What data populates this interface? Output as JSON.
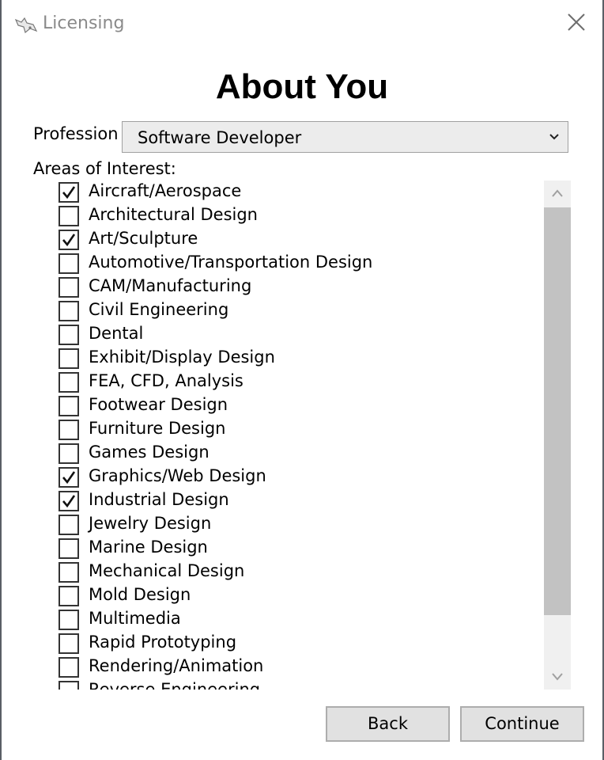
{
  "window": {
    "title": "Licensing"
  },
  "heading": "About You",
  "profession": {
    "label": "Profession",
    "selected": "Software Developer"
  },
  "interests": {
    "label": "Areas of Interest:",
    "items": [
      {
        "label": "Aircraft/Aerospace",
        "checked": true
      },
      {
        "label": "Architectural Design",
        "checked": false
      },
      {
        "label": "Art/Sculpture",
        "checked": true
      },
      {
        "label": "Automotive/Transportation Design",
        "checked": false
      },
      {
        "label": "CAM/Manufacturing",
        "checked": false
      },
      {
        "label": "Civil Engineering",
        "checked": false
      },
      {
        "label": "Dental",
        "checked": false
      },
      {
        "label": "Exhibit/Display Design",
        "checked": false
      },
      {
        "label": "FEA, CFD, Analysis",
        "checked": false
      },
      {
        "label": "Footwear Design",
        "checked": false
      },
      {
        "label": "Furniture Design",
        "checked": false
      },
      {
        "label": "Games Design",
        "checked": false
      },
      {
        "label": "Graphics/Web Design",
        "checked": true
      },
      {
        "label": "Industrial Design",
        "checked": true
      },
      {
        "label": "Jewelry Design",
        "checked": false
      },
      {
        "label": "Marine Design",
        "checked": false
      },
      {
        "label": "Mechanical Design",
        "checked": false
      },
      {
        "label": "Mold Design",
        "checked": false
      },
      {
        "label": "Multimedia",
        "checked": false
      },
      {
        "label": "Rapid Prototyping",
        "checked": false
      },
      {
        "label": "Rendering/Animation",
        "checked": false
      },
      {
        "label": "Reverse Engineering",
        "checked": false
      }
    ]
  },
  "buttons": {
    "back": "Back",
    "continue": "Continue"
  },
  "icons": {
    "app": "rhino-app-icon",
    "close": "close-icon",
    "dropdown": "chevron-down-icon"
  }
}
